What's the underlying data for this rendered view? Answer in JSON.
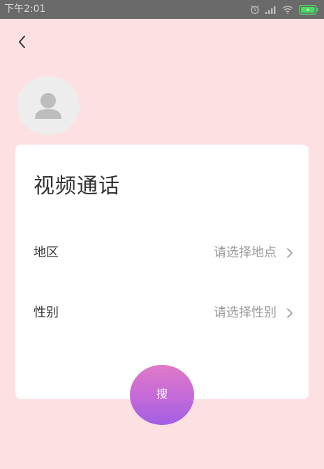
{
  "status_bar": {
    "time": "下午2:01",
    "icons": [
      "alarm-icon",
      "signal-icon",
      "wifi-icon",
      "battery-icon"
    ],
    "battery_color": "#4cd964"
  },
  "nav": {
    "back_icon": "chevron-left-icon"
  },
  "avatar": {
    "icon": "user-silhouette-icon"
  },
  "card": {
    "title": "视频通话",
    "rows": [
      {
        "label": "地区",
        "value": "请选择地点"
      },
      {
        "label": "性别",
        "value": "请选择性别"
      }
    ]
  },
  "search_button": {
    "label": "搜"
  },
  "colors": {
    "page_background": "#fde1e2",
    "card_background": "#ffffff",
    "button_gradient_top": "#e07ac6",
    "button_gradient_bottom": "#a15fe4"
  }
}
